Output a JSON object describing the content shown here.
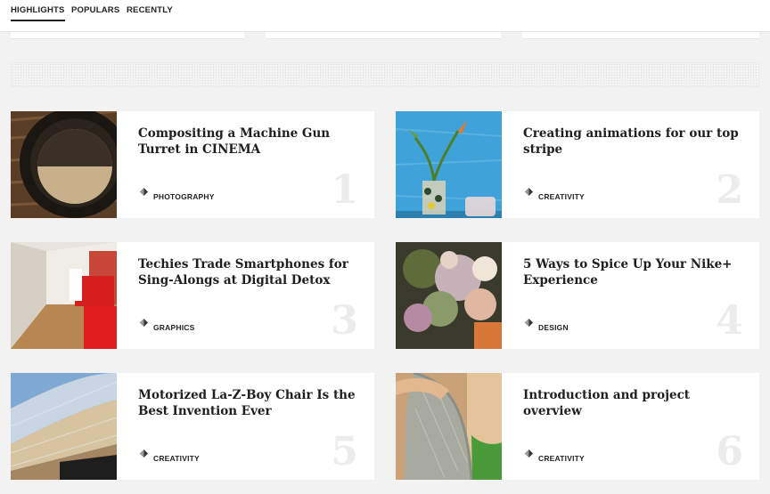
{
  "tabs": [
    {
      "label": "HIGHLIGHTS",
      "active": true
    },
    {
      "label": "POPULARS",
      "active": false
    },
    {
      "label": "RECENTLY",
      "active": false
    }
  ],
  "posts": [
    {
      "title": "Compositing a Machine Gun Turret in CINEMA",
      "category": "PHOTOGRAPHY",
      "rank": "1",
      "image": "coffee-cup-photo"
    },
    {
      "title": "Creating animations for our top stripe",
      "category": "CREATIVITY",
      "rank": "2",
      "image": "flower-vase-photo"
    },
    {
      "title": "Techies Trade Smartphones for Sing-Alongs at Digital Detox",
      "category": "GRAPHICS",
      "rank": "3",
      "image": "hallway-chair-photo"
    },
    {
      "title": "5 Ways to Spice Up Your Nike+ Experience",
      "category": "DESIGN",
      "rank": "4",
      "image": "bouquet-photo"
    },
    {
      "title": "Motorized La-Z-Boy Chair Is the Best Invention Ever",
      "category": "CREATIVITY",
      "rank": "5",
      "image": "building-facade-photo"
    },
    {
      "title": "Introduction and project overview",
      "category": "CREATIVITY",
      "rank": "6",
      "image": "person-chair-photo"
    }
  ],
  "colors": {
    "background": "#f2f2f2",
    "card": "#ffffff",
    "rank_number": "#ececec"
  }
}
